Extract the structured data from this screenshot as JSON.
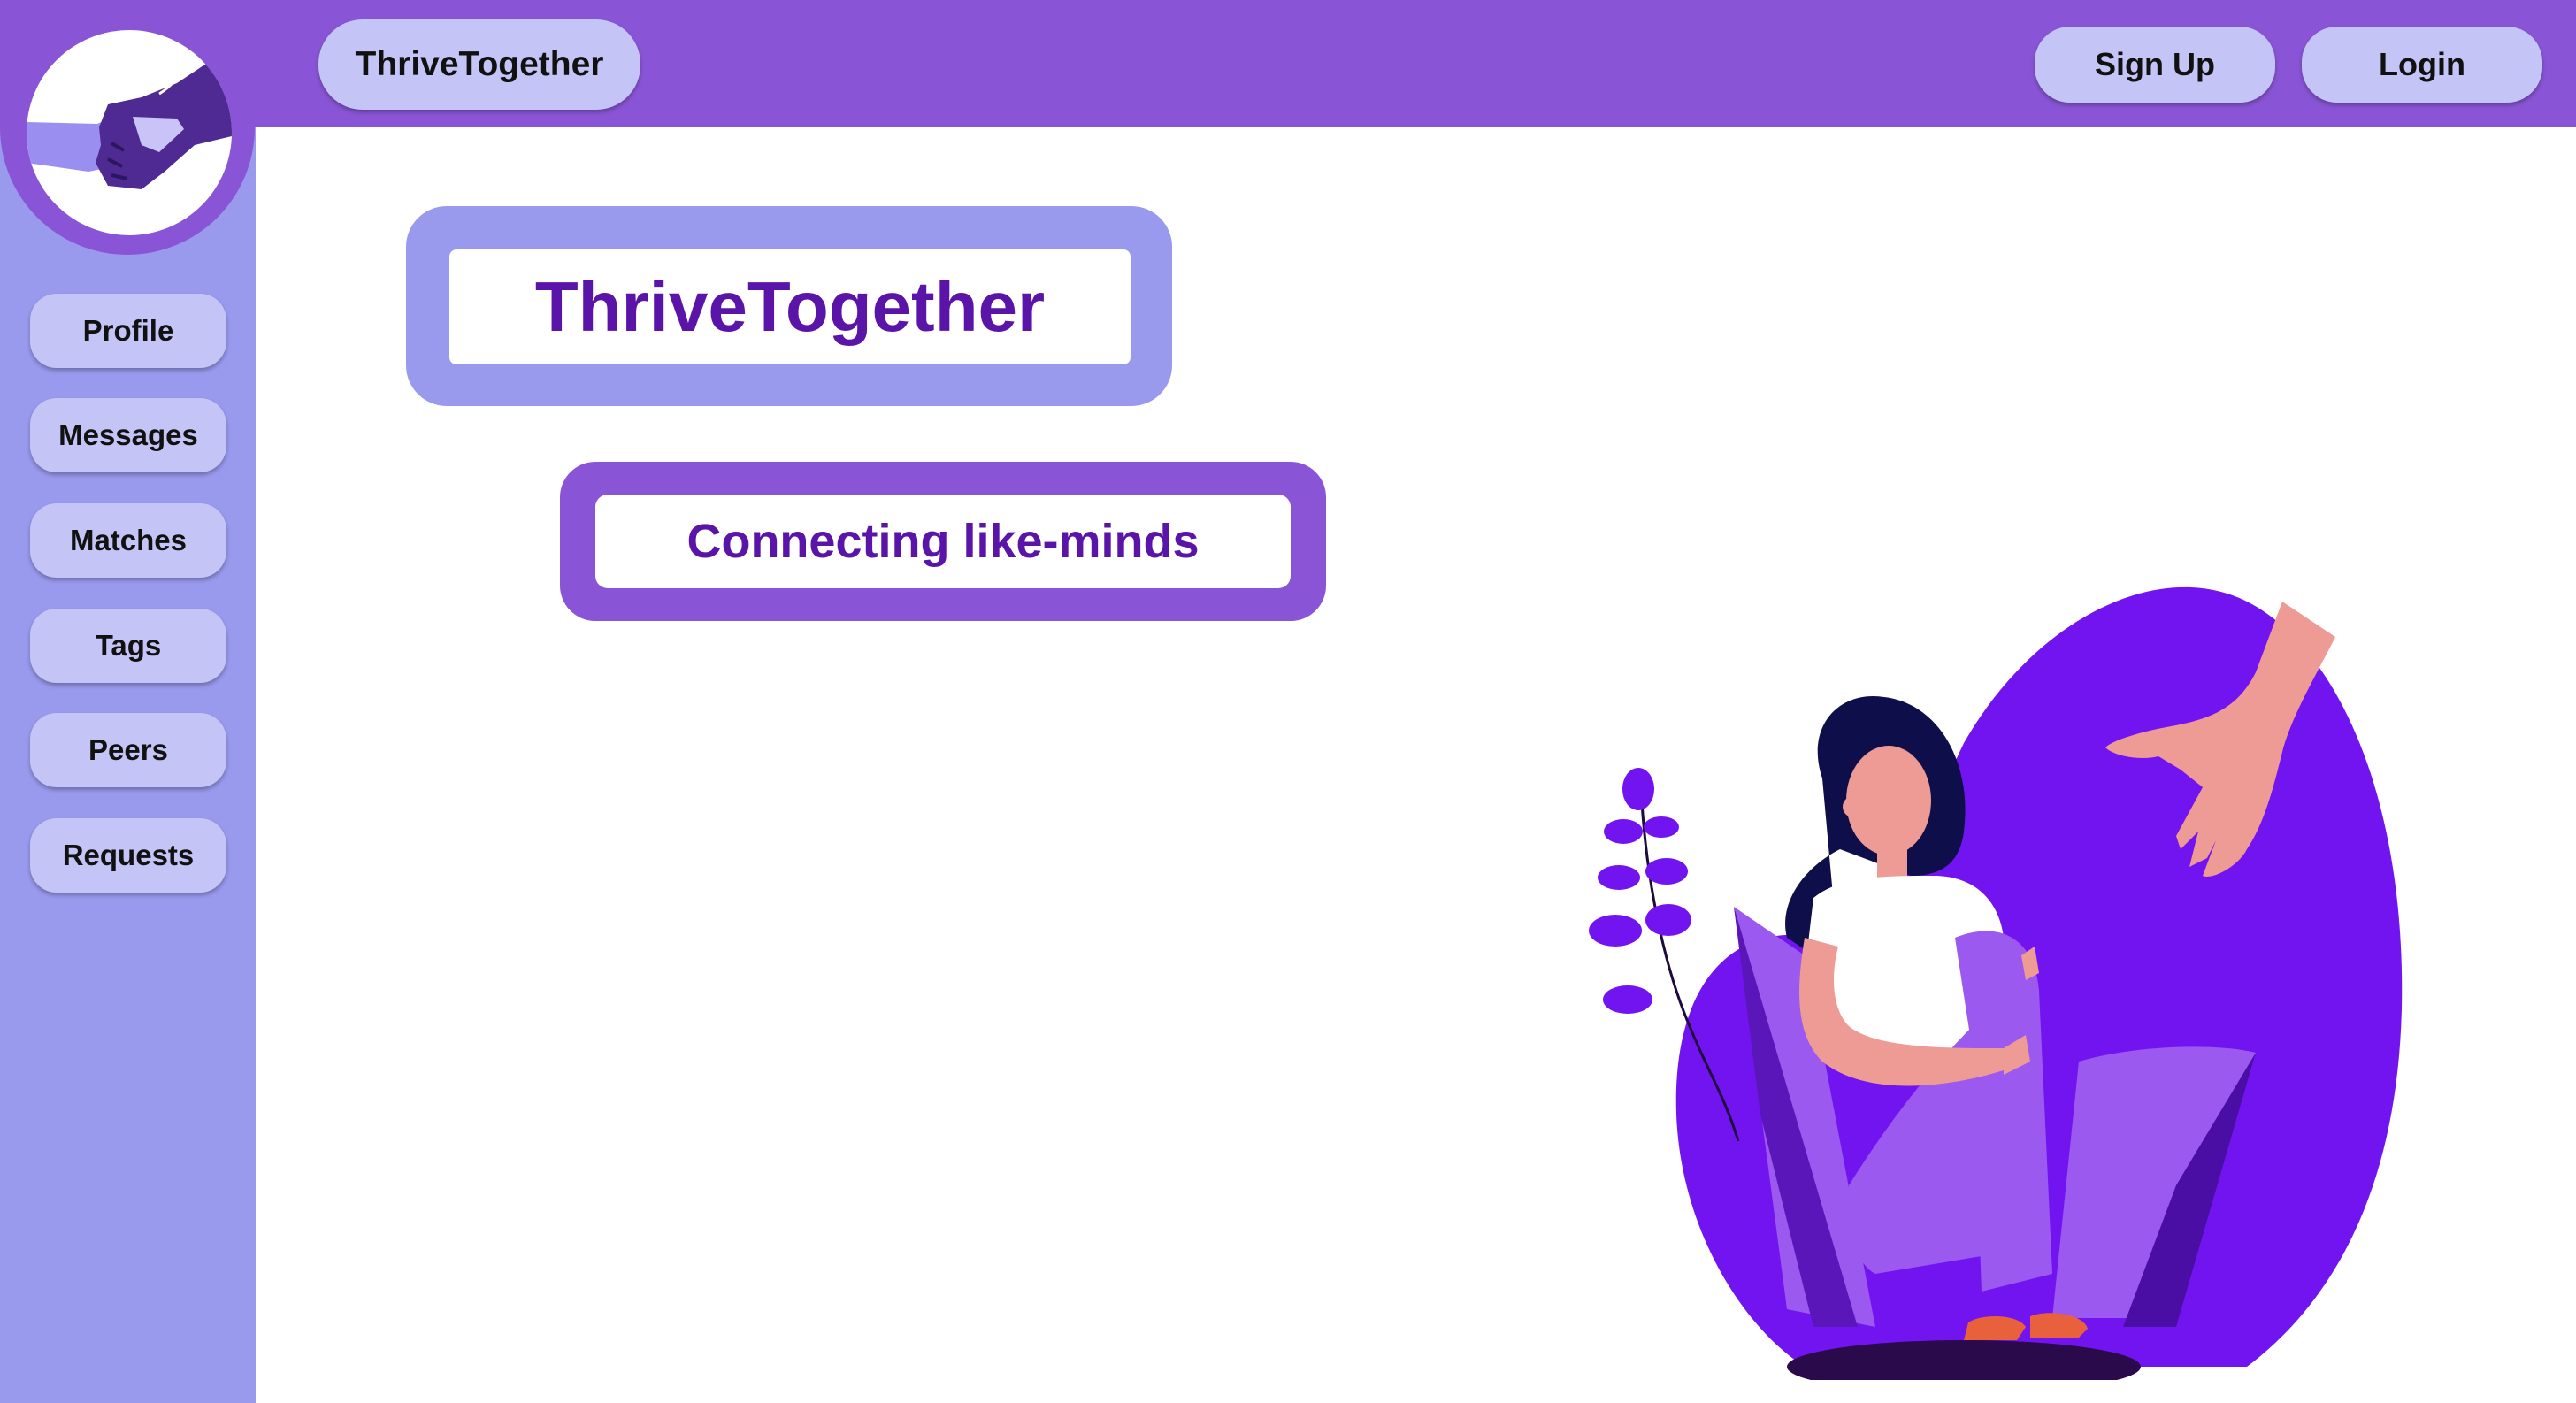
{
  "header": {
    "brand_label": "ThriveTogether",
    "signup_label": "Sign Up",
    "login_label": "Login"
  },
  "sidebar": {
    "logo_icon": "handshake-icon",
    "items": [
      {
        "label": "Profile"
      },
      {
        "label": "Messages"
      },
      {
        "label": "Matches"
      },
      {
        "label": "Tags"
      },
      {
        "label": "Peers"
      },
      {
        "label": "Requests"
      }
    ]
  },
  "hero": {
    "title": "ThriveTogether",
    "subtitle": "Connecting like-minds",
    "illustration_icon": "support-hand-illustration"
  },
  "colors": {
    "header_bg": "#8955d6",
    "sidebar_bg": "#9999ee",
    "pill_bg": "#c4c4f6",
    "title_text": "#5b14a8",
    "illustration_purple": "#7214f0"
  }
}
